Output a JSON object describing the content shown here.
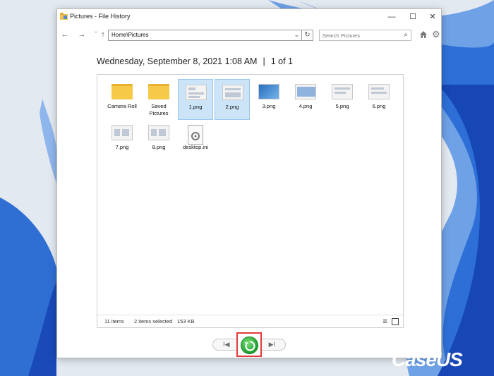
{
  "window": {
    "title": "Pictures - File History",
    "controls": {
      "minimize": "—",
      "maximize": "☐",
      "close": "✕"
    }
  },
  "nav": {
    "back_icon": "←",
    "forward_icon": "→",
    "recent_icon": "ˇ",
    "up_icon": "↑",
    "address": "Home\\Pictures",
    "address_dropdown": "⌄",
    "refresh_icon": "↻",
    "search_placeholder": "Search Pictures",
    "search_icon": "⌕",
    "gear_icon": "⚙"
  },
  "backup": {
    "date": "Wednesday, September 8, 2021 1:08 AM",
    "separator": "|",
    "position": "1 of 1"
  },
  "files": [
    {
      "name": "Camera Roll",
      "type": "folder",
      "selected": false
    },
    {
      "name": "Saved Pictures",
      "type": "folder",
      "selected": false
    },
    {
      "name": "1.png",
      "type": "image",
      "selected": true
    },
    {
      "name": "2.png",
      "type": "image",
      "selected": true
    },
    {
      "name": "3.png",
      "type": "image-blue",
      "selected": false
    },
    {
      "name": "4.png",
      "type": "image",
      "selected": false
    },
    {
      "name": "5.png",
      "type": "image",
      "selected": false
    },
    {
      "name": "6.png",
      "type": "image",
      "selected": false
    },
    {
      "name": "7.png",
      "type": "image",
      "selected": false
    },
    {
      "name": "8.png",
      "type": "image",
      "selected": false
    },
    {
      "name": "desktop.ini",
      "type": "settings-file",
      "selected": false
    }
  ],
  "status": {
    "item_count": "11 items",
    "selection": "2 items selected",
    "size": "153 KB",
    "details_view_icon": "☰"
  },
  "controls": {
    "previous_icon": "I◀",
    "next_icon": "▶I"
  },
  "colors": {
    "selection": "#cce4f7",
    "restore_green": "#1e9e2e",
    "highlight_red": "#e23b3b",
    "desktop_blue": "#1f5fd1"
  },
  "watermark": "CaseUS"
}
